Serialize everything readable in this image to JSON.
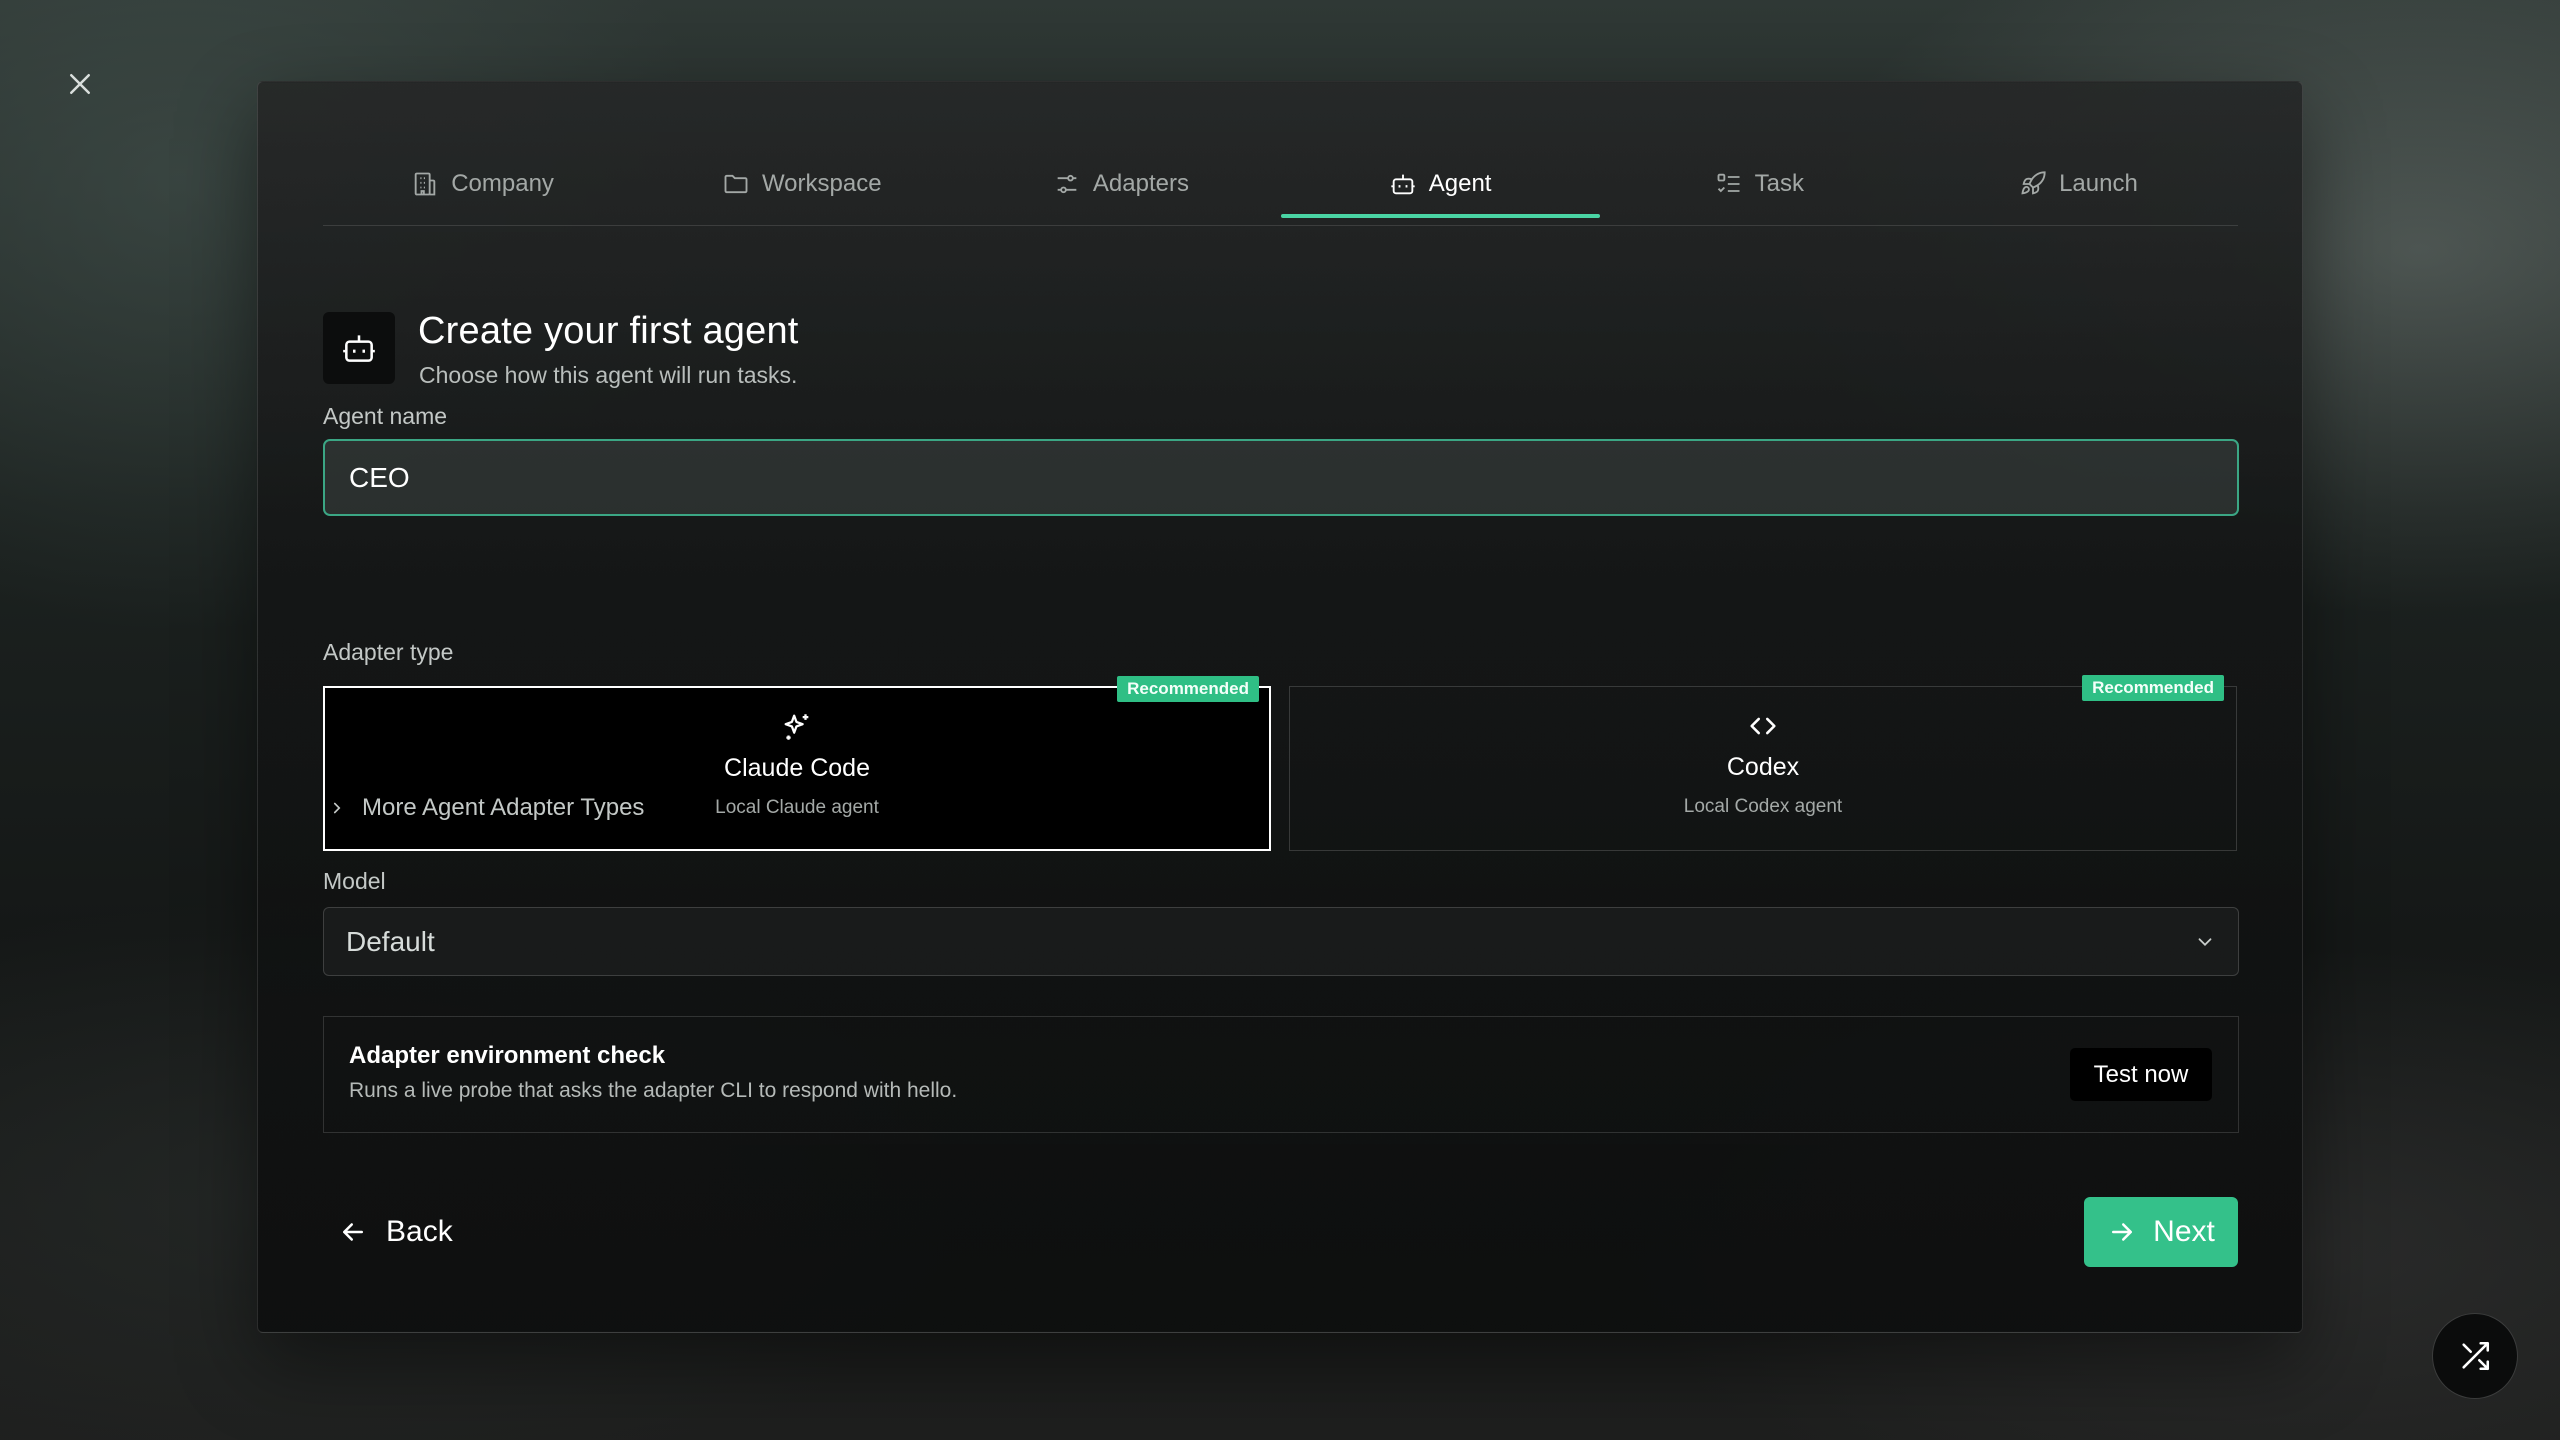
{
  "tabs": [
    {
      "label": "Company",
      "icon": "building-icon"
    },
    {
      "label": "Workspace",
      "icon": "folder-icon"
    },
    {
      "label": "Adapters",
      "icon": "sliders-icon"
    },
    {
      "label": "Agent",
      "icon": "bot-icon"
    },
    {
      "label": "Task",
      "icon": "list-checks-icon"
    },
    {
      "label": "Launch",
      "icon": "rocket-icon"
    }
  ],
  "active_tab": "Agent",
  "header": {
    "title": "Create your first agent",
    "subtitle": "Choose how this agent will run tasks."
  },
  "agent_name": {
    "label": "Agent name",
    "value": "CEO"
  },
  "adapter_type": {
    "label": "Adapter type",
    "options": [
      {
        "title": "Claude Code",
        "subtitle": "Local Claude agent",
        "badge": "Recommended",
        "selected": true,
        "icon": "sparkles-icon"
      },
      {
        "title": "Codex",
        "subtitle": "Local Codex agent",
        "badge": "Recommended",
        "selected": false,
        "icon": "code-icon"
      }
    ],
    "more_label": "More Agent Adapter Types"
  },
  "model": {
    "label": "Model",
    "value": "Default"
  },
  "env_check": {
    "title": "Adapter environment check",
    "description": "Runs a live probe that asks the adapter CLI to respond with hello.",
    "button_label": "Test now"
  },
  "footer": {
    "back_label": "Back",
    "next_label": "Next"
  },
  "colors": {
    "accent": "#34c18a",
    "accent_border": "#3ba684",
    "badge": "#2fbf85"
  }
}
